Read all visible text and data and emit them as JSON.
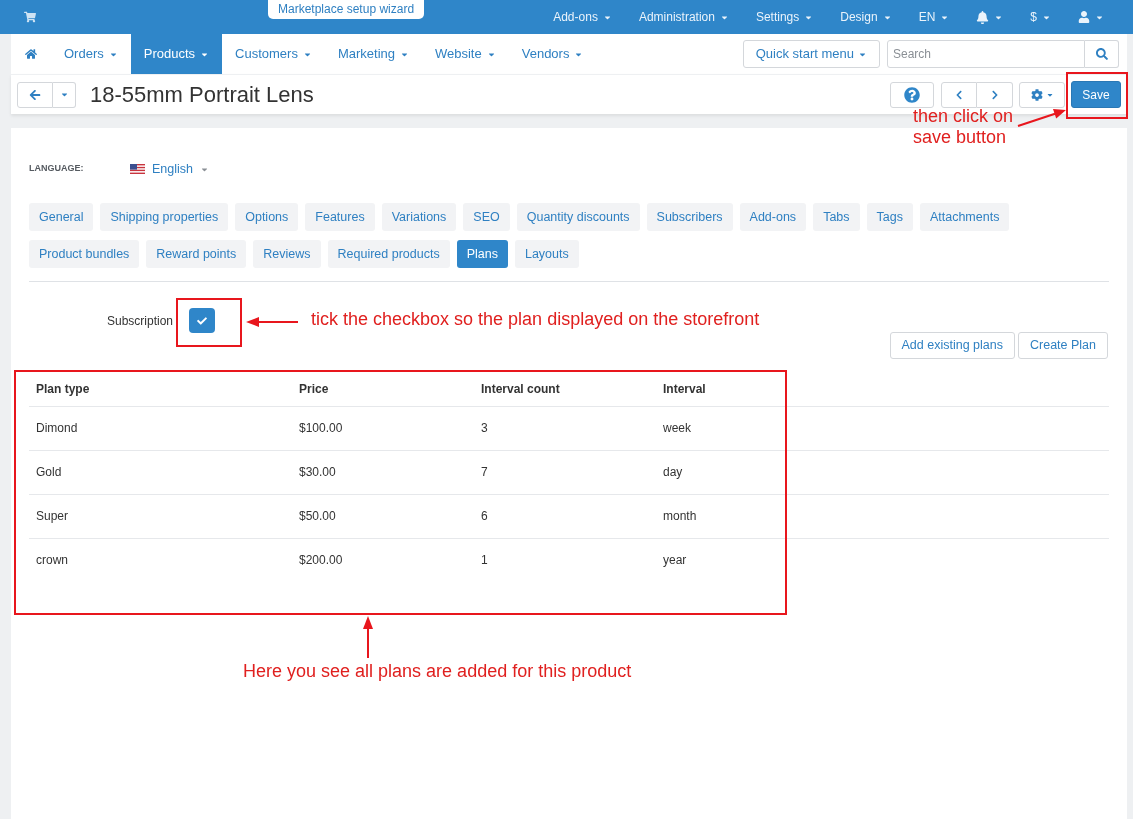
{
  "top_bar": {
    "wizard_tab": "Marketplace setup wizard",
    "menus": [
      {
        "kind": "label",
        "label": "Add-ons"
      },
      {
        "kind": "label",
        "label": "Administration"
      },
      {
        "kind": "label",
        "label": "Settings"
      },
      {
        "kind": "label",
        "label": "Design"
      },
      {
        "kind": "label",
        "label": "EN"
      },
      {
        "kind": "notifications"
      },
      {
        "kind": "label",
        "label": "$"
      },
      {
        "kind": "account"
      }
    ]
  },
  "nav": {
    "items": [
      {
        "label": "Orders",
        "selected": false
      },
      {
        "label": "Products",
        "selected": true
      },
      {
        "label": "Customers",
        "selected": false
      },
      {
        "label": "Marketing",
        "selected": false
      },
      {
        "label": "Website",
        "selected": false
      },
      {
        "label": "Vendors",
        "selected": false
      }
    ],
    "quick_start": "Quick start menu",
    "search": {
      "placeholder": "Search"
    }
  },
  "title_bar": {
    "title": "18-55mm Portrait Lens",
    "save": "Save"
  },
  "language": {
    "label": "LANGUAGE:",
    "value": "English"
  },
  "tab_rows": [
    {
      "tabs": [
        {
          "label": "General",
          "selected": false
        },
        {
          "label": "Shipping properties",
          "selected": false
        },
        {
          "label": "Options",
          "selected": false
        },
        {
          "label": "Features",
          "selected": false
        },
        {
          "label": "Variations",
          "selected": false
        },
        {
          "label": "SEO",
          "selected": false
        },
        {
          "label": "Quantity discounts",
          "selected": false
        },
        {
          "label": "Subscribers",
          "selected": false
        },
        {
          "label": "Add-ons",
          "selected": false
        },
        {
          "label": "Tabs",
          "selected": false
        },
        {
          "label": "Tags",
          "selected": false
        },
        {
          "label": "Attachments",
          "selected": false
        }
      ]
    },
    {
      "tabs": [
        {
          "label": "Product bundles",
          "selected": false
        },
        {
          "label": "Reward points",
          "selected": false
        },
        {
          "label": "Reviews",
          "selected": false
        },
        {
          "label": "Required products",
          "selected": false
        },
        {
          "label": "Plans",
          "selected": true
        },
        {
          "label": "Layouts",
          "selected": false
        }
      ]
    }
  ],
  "subscription": {
    "label": "Subscription",
    "checked": true
  },
  "plan_actions": [
    "Add existing plans",
    "Create Plan"
  ],
  "plans_table": {
    "columns": [
      "Plan type",
      "Price",
      "Interval count",
      "Interval"
    ],
    "rows": [
      [
        "Dimond",
        "$100.00",
        "3",
        "week"
      ],
      [
        "Gold",
        "$30.00",
        "7",
        "day"
      ],
      [
        "Super",
        "$50.00",
        "6",
        "month"
      ],
      [
        "crown",
        "$200.00",
        "1",
        "year"
      ]
    ]
  },
  "annotations": [
    {
      "kind": "save",
      "text": "then click on save button"
    },
    {
      "kind": "checkbox",
      "text": "tick the checkbox so the plan displayed on the storefront"
    },
    {
      "kind": "table",
      "text": "Here you see all plans are added for this product"
    }
  ]
}
